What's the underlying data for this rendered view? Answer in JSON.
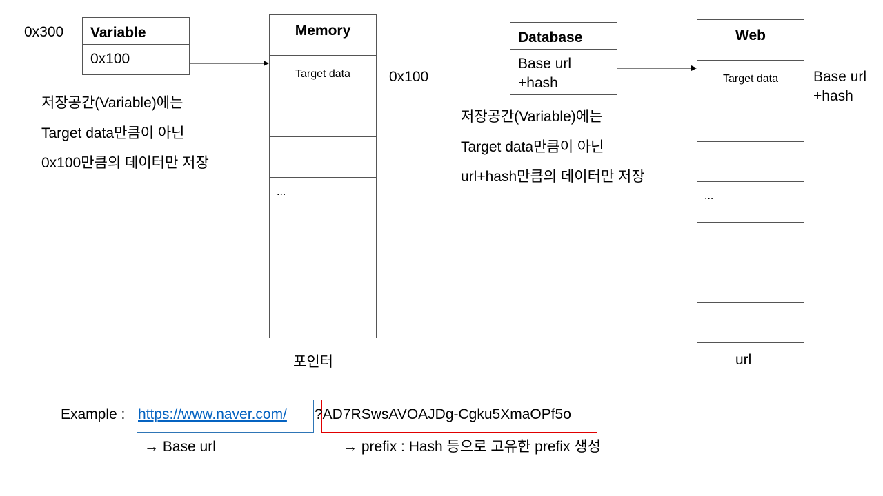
{
  "left": {
    "address_label": "0x300",
    "variable": {
      "header": "Variable",
      "value": "0x100"
    },
    "memory": {
      "header": "Memory",
      "target_cell": "Target data",
      "ellipsis": "...",
      "address_label": "0x100"
    },
    "desc_lines": [
      "저장공간(Variable)에는",
      "Target data만큼이 아닌",
      "0x100만큼의 데이터만 저장"
    ],
    "caption": "포인터"
  },
  "right": {
    "database": {
      "header": "Database",
      "value_line1": "Base url",
      "value_line2": "+hash"
    },
    "web": {
      "header": "Web",
      "target_cell": "Target data",
      "ellipsis": "...",
      "label_line1": "Base url",
      "label_line2": "+hash"
    },
    "desc_lines": [
      "저장공간(Variable)에는",
      "Target data만큼이 아닌",
      "url+hash만큼의 데이터만 저장"
    ],
    "caption": "url"
  },
  "example": {
    "label": "Example : ",
    "url": "https://www.naver.com/",
    "query": "?AD7RSwsAVOAJDg-Cgku5XmaOPf5o",
    "base_note": "Base url",
    "prefix_note": "prefix : Hash 등으로 고유한 prefix 생성",
    "arrow_glyph": "→",
    "colors": {
      "url_box": "#2e75b6",
      "hash_box": "#e00000",
      "link": "#0563c1"
    }
  }
}
